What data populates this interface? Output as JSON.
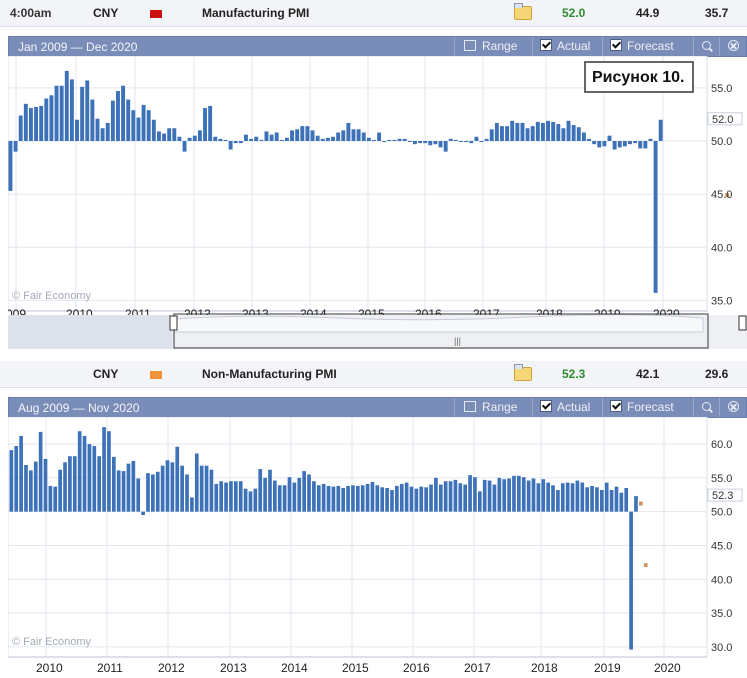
{
  "rows": [
    {
      "time": "4:00am",
      "currency": "CNY",
      "title": "Manufacturing PMI",
      "actual": "52.0",
      "forecast": "44.9",
      "previous": "35.7"
    },
    {
      "time": "",
      "currency": "CNY",
      "title": "Non-Manufacturing PMI",
      "actual": "52.3",
      "forecast": "42.1",
      "previous": "29.6"
    }
  ],
  "toolbar": {
    "range": "Range",
    "actual": "Actual",
    "forecast": "Forecast"
  },
  "watermark": "© Fair Economy",
  "annotation": "Рисунок 10.",
  "colors": {
    "actual": "#3d72b8",
    "forecast": "#c99564",
    "header": "#7a8cb8",
    "grid": "#e2e6ee"
  },
  "chart_data": [
    {
      "type": "bar",
      "range_label": "Jan 2009 — Dec 2020",
      "x_ticks": [
        "009",
        "2010",
        "2011",
        "2012",
        "2013",
        "2014",
        "2015",
        "2016",
        "2017",
        "2018",
        "2019",
        "2020"
      ],
      "y_ticks": [
        "55.0",
        "50.0",
        "45.0",
        "40.0",
        "35.0"
      ],
      "ylim": [
        34.0,
        58.0
      ],
      "baseline": 50.0,
      "last_value_label": "52.0",
      "series": [
        {
          "name": "Actual",
          "start": "2009-01",
          "values": [
            45.3,
            49.0,
            52.4,
            53.5,
            53.1,
            53.2,
            53.3,
            54.0,
            54.3,
            55.2,
            55.2,
            56.6,
            55.8,
            52.0,
            55.1,
            55.7,
            53.9,
            52.1,
            51.2,
            51.7,
            53.8,
            54.7,
            55.2,
            53.9,
            52.9,
            52.2,
            53.4,
            52.9,
            52.0,
            50.9,
            50.7,
            51.2,
            51.2,
            50.4,
            49.0,
            50.3,
            50.5,
            51.0,
            53.1,
            53.3,
            50.4,
            50.2,
            50.1,
            49.2,
            49.8,
            49.8,
            50.6,
            50.2,
            50.4,
            50.1,
            50.9,
            50.6,
            50.8,
            50.1,
            50.3,
            51.0,
            51.1,
            51.4,
            51.4,
            51.0,
            50.5,
            50.2,
            50.3,
            50.4,
            50.8,
            51.0,
            51.7,
            51.1,
            51.1,
            50.8,
            50.3,
            50.1,
            50.8,
            49.9,
            50.1,
            50.1,
            50.2,
            50.2,
            50.0,
            49.7,
            49.8,
            49.8,
            49.6,
            49.7,
            49.4,
            49.0,
            50.2,
            50.1,
            50.0,
            49.9,
            49.8,
            50.4,
            50.0,
            50.2,
            51.1,
            51.7,
            51.4,
            51.4,
            51.9,
            51.7,
            51.7,
            51.2,
            51.4,
            51.8,
            51.7,
            51.9,
            51.8,
            51.6,
            51.2,
            51.9,
            51.5,
            51.3,
            50.8,
            50.2,
            49.7,
            49.4,
            49.5,
            50.5,
            49.2,
            49.4,
            49.5,
            49.7,
            49.8,
            49.3,
            49.3,
            50.2,
            35.7,
            52.0
          ]
        },
        {
          "name": "Forecast",
          "start": "2009-01",
          "values": [
            null,
            null,
            null,
            null,
            null,
            null,
            null,
            null,
            null,
            null,
            null,
            null,
            null,
            null,
            null,
            null,
            null,
            null,
            null,
            null,
            null,
            null,
            null,
            null,
            null,
            null,
            null,
            null,
            null,
            null,
            null,
            null,
            null,
            null,
            null,
            null,
            null,
            null,
            null,
            null,
            null,
            null,
            null,
            null,
            null,
            null,
            null,
            null,
            null,
            null,
            null,
            null,
            null,
            null,
            null,
            null,
            null,
            null,
            null,
            null,
            null,
            null,
            null,
            null,
            null,
            null,
            null,
            null,
            null,
            null,
            null,
            null,
            null,
            null,
            null,
            null,
            null,
            null,
            null,
            null,
            null,
            null,
            null,
            null,
            null,
            null,
            null,
            null,
            null,
            null,
            null,
            null,
            null,
            null,
            null,
            null,
            null,
            null,
            null,
            null,
            null,
            null,
            null,
            null,
            null,
            null,
            null,
            null,
            null,
            null,
            null,
            null,
            null,
            null,
            null,
            null,
            null,
            null,
            null,
            null,
            null,
            null,
            null,
            null,
            null,
            null,
            null,
            null,
            null,
            null,
            null,
            null,
            null,
            null,
            null,
            null,
            null,
            null,
            null,
            null,
            44.9,
            null
          ]
        }
      ]
    },
    {
      "type": "bar",
      "range_label": "Aug 2009 — Nov 2020",
      "x_ticks": [
        "2010",
        "2011",
        "2012",
        "2013",
        "2014",
        "2015",
        "2016",
        "2017",
        "2018",
        "2019",
        "2020"
      ],
      "y_ticks": [
        "60.0",
        "55.0",
        "50.0",
        "45.0",
        "40.0",
        "35.0",
        "30.0"
      ],
      "ylim": [
        28.5,
        64.0
      ],
      "baseline": 50.0,
      "last_value_label": "52.3",
      "series": [
        {
          "name": "Actual",
          "start": "2009-08",
          "values": [
            59.1,
            59.7,
            61.2,
            56.9,
            56.1,
            57.4,
            61.8,
            57.8,
            53.8,
            53.7,
            56.2,
            57.3,
            58.2,
            58.2,
            61.9,
            61.2,
            60.0,
            59.7,
            58.2,
            62.5,
            61.9,
            58.1,
            56.1,
            56.0,
            57.1,
            57.5,
            54.9,
            49.5,
            55.7,
            55.5,
            55.9,
            56.8,
            57.6,
            57.3,
            59.6,
            56.8,
            55.5,
            52.1,
            58.6,
            56.8,
            56.8,
            56.2,
            54.1,
            54.5,
            54.3,
            54.5,
            54.5,
            54.5,
            53.4,
            53.0,
            53.4,
            56.3,
            55.0,
            56.2,
            54.6,
            53.9,
            53.9,
            55.1,
            54.3,
            55.0,
            56.0,
            55.5,
            54.5,
            53.9,
            54.1,
            53.8,
            53.7,
            53.8,
            53.5,
            53.8,
            53.9,
            53.8,
            53.9,
            54.1,
            54.4,
            53.9,
            53.6,
            53.5,
            53.2,
            53.8,
            54.1,
            54.3,
            53.7,
            53.4,
            53.7,
            53.6,
            54.0,
            55.0,
            54.0,
            54.5,
            54.5,
            54.7,
            54.2,
            54.0,
            55.4,
            55.1,
            53.0,
            54.7,
            54.6,
            54.0,
            55.0,
            54.8,
            54.9,
            55.3,
            55.3,
            55.1,
            54.6,
            54.9,
            54.2,
            54.8,
            54.3,
            53.9,
            53.2,
            54.2,
            54.3,
            54.2,
            54.6,
            54.3,
            53.6,
            53.8,
            53.6,
            53.2,
            54.3,
            53.2,
            53.7,
            52.8,
            53.5,
            29.6,
            52.3
          ]
        },
        {
          "name": "Forecast",
          "start": "2009-08",
          "values": [
            null,
            null,
            null,
            null,
            null,
            null,
            null,
            null,
            null,
            null,
            null,
            null,
            null,
            null,
            null,
            null,
            null,
            null,
            null,
            null,
            null,
            null,
            null,
            null,
            null,
            null,
            null,
            null,
            null,
            null,
            null,
            null,
            null,
            null,
            null,
            null,
            null,
            null,
            null,
            null,
            null,
            null,
            null,
            null,
            null,
            null,
            null,
            null,
            null,
            null,
            null,
            null,
            null,
            null,
            null,
            null,
            null,
            null,
            null,
            null,
            null,
            null,
            null,
            null,
            null,
            null,
            null,
            null,
            null,
            null,
            null,
            null,
            null,
            null,
            null,
            null,
            null,
            null,
            null,
            null,
            null,
            null,
            null,
            null,
            null,
            null,
            null,
            null,
            null,
            null,
            null,
            null,
            null,
            null,
            null,
            null,
            null,
            null,
            null,
            null,
            null,
            null,
            null,
            null,
            null,
            null,
            null,
            null,
            null,
            null,
            null,
            null,
            null,
            null,
            null,
            null,
            null,
            null,
            null,
            null,
            null,
            null,
            null,
            null,
            null,
            null,
            null,
            null,
            null,
            51.2,
            42.1,
            null
          ]
        }
      ]
    }
  ]
}
